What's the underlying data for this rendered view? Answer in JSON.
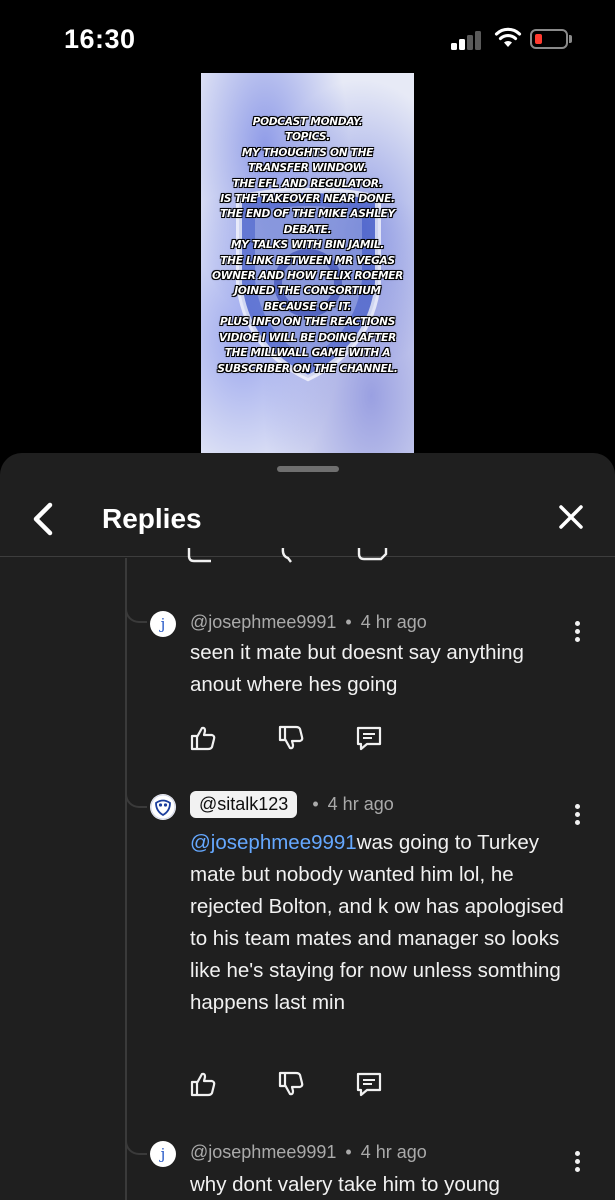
{
  "status_bar": {
    "time": "16:30",
    "battery_color": "#ff3b30"
  },
  "video": {
    "thumbnail_lines": [
      "Podcast Monday.",
      "Topics.",
      "My thoughts on the",
      "transfer window.",
      "The EFL and regulator.",
      "Is the takeover near done.",
      "The end of the Mike Ashley",
      "debate.",
      "My talks with Bin Jamil.",
      "The link between Mr Vegas",
      "owner and how Felix Roemer",
      "joined the consortium",
      "because of it.",
      "Plus info on the reactions",
      "vidioe I will be doing after",
      "the Millwall game with a",
      "subscriber on the channel."
    ]
  },
  "replies_panel": {
    "title": "Replies",
    "back_icon": "chevron-left-icon",
    "close_icon": "close-icon",
    "comments": [
      {
        "avatar_letter": "j",
        "author": "@josephmee9991",
        "separator": "•",
        "time": "4 hr ago",
        "text": "seen it mate but doesnt say anything anout where hes going"
      },
      {
        "avatar_icon": "owl-crest-avatar",
        "author": "@sitalk123",
        "separator": "•",
        "time": "4 hr ago",
        "mention": "@josephmee9991",
        "text": "was going to Turkey mate but nobody wanted him lol, he rejected Bolton, and k ow has apologised to his team mates and manager so looks like he's staying for now unless somthing happens last min"
      },
      {
        "avatar_letter": "j",
        "author": "@josephmee9991",
        "separator": "•",
        "time": "4 hr ago",
        "text": "why dont valery take him to young"
      }
    ]
  },
  "colors": {
    "panel_bg": "#1f1f1f",
    "mention": "#65a8ff",
    "meta": "#aaaaaa",
    "avatar_letter": "#2456c6"
  }
}
